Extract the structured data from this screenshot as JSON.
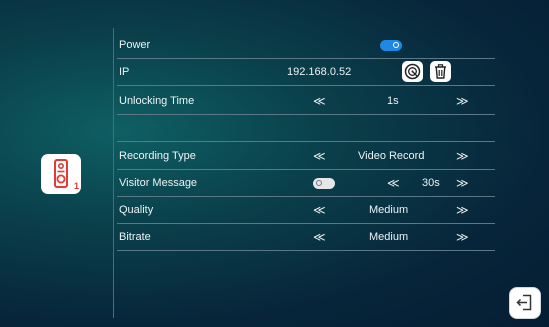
{
  "settings": {
    "power": {
      "label": "Power",
      "enabled": true
    },
    "ip": {
      "label": "IP",
      "value": "192.168.0.52"
    },
    "unlocking_time": {
      "label": "Unlocking Time",
      "value": "1s"
    },
    "recording_type": {
      "label": "Recording Type",
      "value": "Video Record"
    },
    "visitor_message": {
      "label": "Visitor Message",
      "enabled": false,
      "value": "30s"
    },
    "quality": {
      "label": "Quality",
      "value": "Medium"
    },
    "bitrate": {
      "label": "Bitrate",
      "value": "Medium"
    }
  },
  "device": {
    "number": "1",
    "icon": "doorbell-icon"
  },
  "icons": {
    "left": "double-chevron-left-icon",
    "right": "double-chevron-right-icon",
    "scan": "scan-icon",
    "delete": "trash-icon",
    "exit": "exit-icon"
  },
  "arrows": {
    "left": "≪",
    "right": "≫"
  },
  "colors": {
    "accent": "#1e88e5",
    "device": "#e53935"
  }
}
